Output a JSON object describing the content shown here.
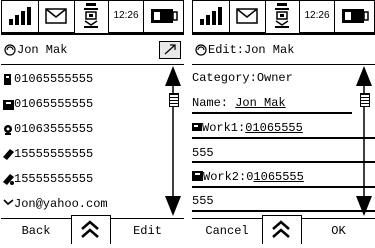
{
  "left_screen": {
    "status": {
      "time": "12:26"
    },
    "title": "Jon Mak",
    "entries": [
      {
        "icon": "office-phone-icon",
        "value": "01065555555"
      },
      {
        "icon": "fax-icon",
        "value": "01065555555"
      },
      {
        "icon": "home-phone-icon",
        "value": "01063555555"
      },
      {
        "icon": "mobile-phone-icon",
        "value": "15555555555"
      },
      {
        "icon": "mobile-phone-2-icon",
        "value": "15555555555"
      },
      {
        "icon": "email-icon",
        "value": "Jon@yahoo.com"
      }
    ],
    "softkeys": {
      "left": "Back",
      "right": "Edit"
    }
  },
  "right_screen": {
    "status": {
      "time": "12:26"
    },
    "title": "Edit:Jon Mak",
    "category": {
      "label": "Category:",
      "value": "Owner"
    },
    "name": {
      "label": "Name:",
      "value": "Jon Mak"
    },
    "work1": {
      "label": "Work1:",
      "value_line1": "01065555",
      "value_line2": "555"
    },
    "work2": {
      "label": "Work2:",
      "value_prefix": "0",
      "value_line1": "1065555",
      "value_line2": "555"
    },
    "softkeys": {
      "left": "Cancel",
      "right": "OK"
    }
  }
}
